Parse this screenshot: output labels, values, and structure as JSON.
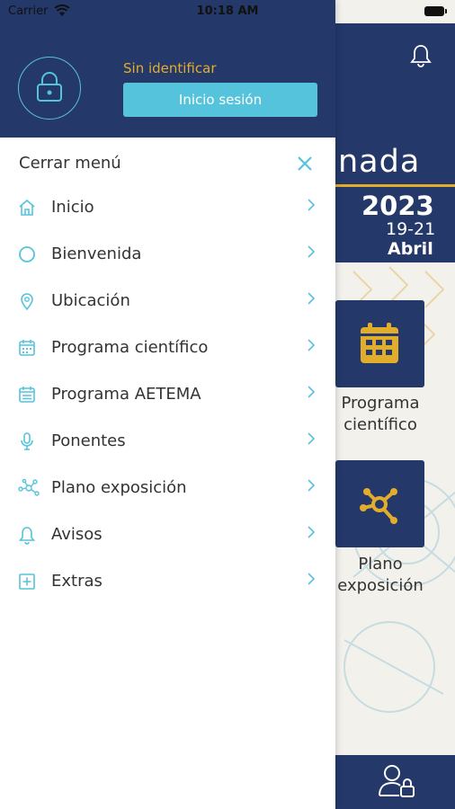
{
  "status_bar": {
    "carrier": "Carrier",
    "time": "10:18 AM"
  },
  "drawer": {
    "user_status": "Sin identificar",
    "login_button": "Inicio sesión",
    "close_label": "Cerrar menú",
    "items": [
      {
        "label": "Inicio",
        "icon": "home-icon"
      },
      {
        "label": "Bienvenida",
        "icon": "circle-icon"
      },
      {
        "label": "Ubicación",
        "icon": "location-pin-icon"
      },
      {
        "label": "Programa científico",
        "icon": "calendar-icon"
      },
      {
        "label": "Programa AETEMA",
        "icon": "calendar-list-icon"
      },
      {
        "label": "Ponentes",
        "icon": "microphone-icon"
      },
      {
        "label": "Plano exposición",
        "icon": "network-icon"
      },
      {
        "label": "Avisos",
        "icon": "bell-icon"
      },
      {
        "label": "Extras",
        "icon": "plus-square-icon"
      }
    ]
  },
  "background_app": {
    "banner_title": "nada",
    "banner_year": "2023",
    "banner_days": "19-21",
    "banner_month": "Abril",
    "tiles": [
      {
        "label": "Programa científico",
        "icon": "calendar-icon"
      },
      {
        "label": "Plano exposición",
        "icon": "network-icon"
      }
    ]
  },
  "colors": {
    "navy": "#24386a",
    "accent_cyan": "#55c3dc",
    "accent_gold": "#e3ad2c"
  }
}
